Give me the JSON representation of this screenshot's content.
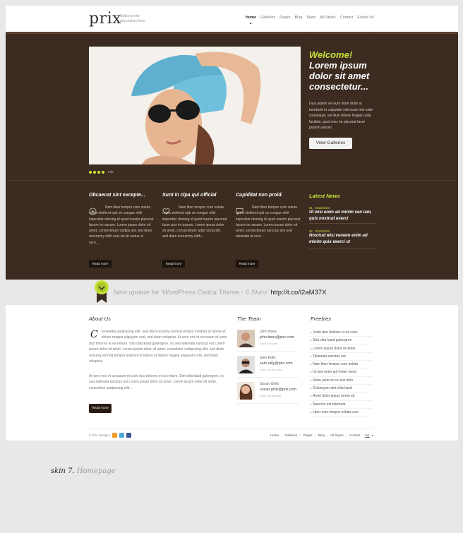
{
  "header": {
    "logo": "prix",
    "description": "Optional site description here",
    "nav": [
      "Home",
      "Galleries",
      "Pages",
      "Blog",
      "Skins",
      "All Styles",
      "Contact",
      "Follow Us"
    ],
    "active_nav": "Home"
  },
  "hero": {
    "welcome": "Welcome!",
    "headline": "Lorem ipsum dolor sit amet consectetur...",
    "text": "Duis autem vel eum iriure dolor in hendrerit in vulputate velit esse mol estie consequat, vel illum dolore feugiat nulla facilisis, quod mez im placerat facer possim assum.",
    "button": "View Galleries",
    "slider_label": "Info"
  },
  "features": [
    {
      "title": "Obcaecat sint excepte...",
      "icon": "circle-icon",
      "text": "Nam liber tempor cum soluta nobis eleifend opti on congue nihil imperdiet doming id quod mazim placerat facere im assum. Lorem ipsum dolor sit amet, consectetuer sadips ses sed diam nonummy nibh eius tat sit varius ut vero...",
      "button": "Read more"
    },
    {
      "title": "Sunt in clpa qui official",
      "icon": "heart-icon",
      "text": "Nam liber tempor cum soluta nobis eleifend opti on congue nihil imperdiet doming id quod mazim placerat facer pos im assum. Lorem ipsum dolor sit amet, consectetuer adipi scing elit, sed diam nonummy nibh...",
      "button": "Read more"
    },
    {
      "title": "Cupiditat non proid.",
      "icon": "comment-icon",
      "text": "Nam liber tempor cum soluta nobis eleifend opti on congue nihil imperdiet doming id quod mazim placerat facere im assum. Lorem ipsum dolor sit amet, consectetuer sanctus ses sed takimata ut vero...",
      "button": "Read more"
    }
  ],
  "news": {
    "heading": "Latest News",
    "items": [
      {
        "num": "01.",
        "date": "2011/04/24",
        "title": "Ut wisi enim ad minim ven iam, quis nostrud exerci"
      },
      {
        "num": "02.",
        "date": "2011/04/03",
        "title": "Nostrud wisi veniam enim ad minim quis exerci ut"
      }
    ]
  },
  "twitter": {
    "text": "New update for 'WordPress Cadca Theme - 6 Skins'",
    "link": "http://t.co/l2aM37X"
  },
  "about": {
    "heading": "About Us",
    "dropcap": "C",
    "p1": "onsetetur sadipscing elitr, sed diam nonumy eirmod tempor invidunt ut labore et dolore magna aliquyam erat, sed diam voluptua. At vero eos et accusam et justo duo dolores et ea rebum. Stet clita kasd gubergren, no sea takimata sanctus est Lorem ipsum dolor sit amet. Lorem ipsum dolor sit amet, consetetur sadipscing elitr, sed diam nonumy eirmod tempor invidunt ut labore et dolore magna aliquyam erat, sed diam voluptua.",
    "p2": "At vero eos et accusam et justo duo dolores et ea rebum. Stet clita kasd gubergren, no sea takimata sanctus est Lorem ipsum dolor sit amet. Lorem ipsum dolor sit amet, consetetur sadipscing elitr...",
    "button": "Read more"
  },
  "team": {
    "heading": "The Team",
    "members": [
      {
        "name": "John Boes",
        "email": "john.boes@prix.com",
        "role": "Role: Founder"
      },
      {
        "name": "Sam Rally",
        "email": "sam.rally@prix.com",
        "role": "Role: Co Founder"
      },
      {
        "name": "Susan Ghils",
        "email": "susan.ghils@prix.com",
        "role": "Role: Art Director"
      }
    ]
  },
  "freebies": {
    "heading": "Freebies",
    "items": [
      "Justo duo dolores et ea rebu",
      "Stet clita kasd gubergren",
      "Lorem ipsum dolor sit amet",
      "Takimata sanctus est",
      "Nam liber tempor cum soluta",
      "Ut wisi enim ad minim venia",
      "Rebu justo et ea duo dolo",
      "Gubergren stet clita kasd",
      "Amet dolor ipsum lorem sit",
      "Sanctus est takimata",
      "Liber nam tempor soluta cum"
    ]
  },
  "footer": {
    "copyright": "© Prix Design |",
    "nav": [
      "Home",
      "Galleries",
      "Pages",
      "Blog",
      "All Styles",
      "Contact"
    ],
    "top": "top"
  },
  "caption": {
    "skin": "skin 7.",
    "page": "Homepage"
  },
  "colors": {
    "accent": "#c8e23a",
    "dark_bg": "#3b2a1f",
    "button_dark": "#1d130d"
  }
}
